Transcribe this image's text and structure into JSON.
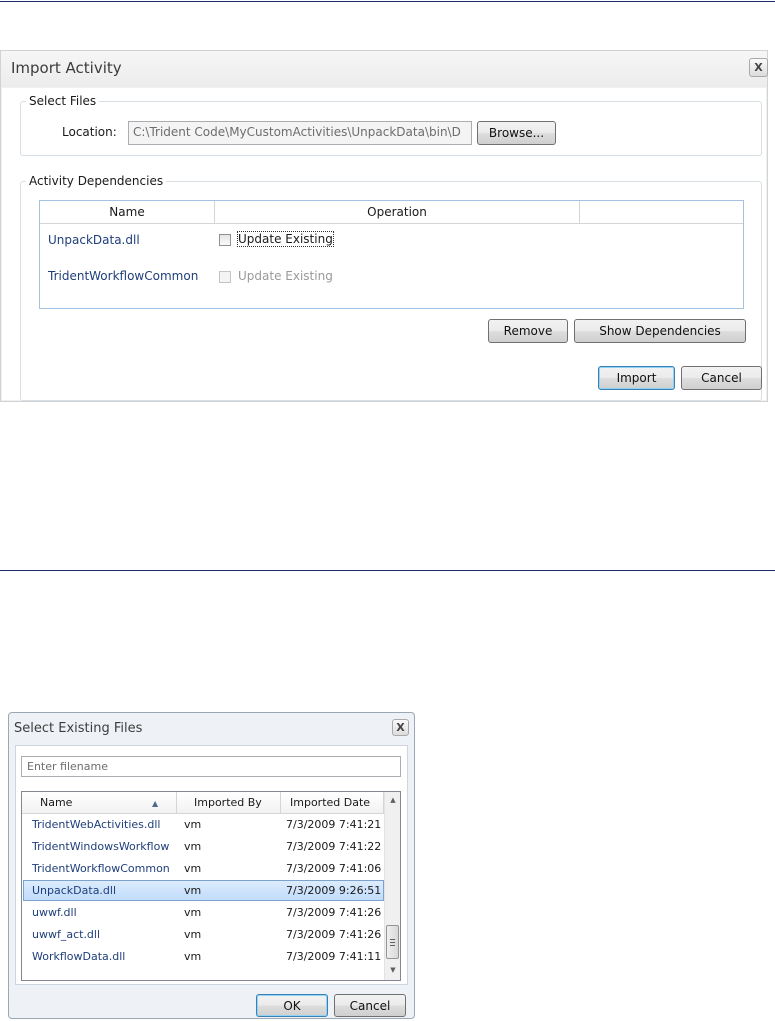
{
  "import_dialog": {
    "title": "Import Activity",
    "close_label": "X",
    "select_files": {
      "legend": "Select Files",
      "location_label": "Location:",
      "location_value": "C:\\Trident Code\\MyCustomActivities\\UnpackData\\bin\\D",
      "browse_label": "Browse..."
    },
    "dependencies": {
      "legend": "Activity Dependencies",
      "columns": [
        "Name",
        "Operation"
      ],
      "rows": [
        {
          "name": "UnpackData.dll",
          "operation": "Update Existing",
          "enabled": true,
          "checked": false
        },
        {
          "name": "TridentWorkflowCommon",
          "operation": "Update Existing",
          "enabled": false,
          "checked": false
        }
      ],
      "remove_label": "Remove",
      "show_dependencies_label": "Show Dependencies"
    },
    "import_label": "Import",
    "cancel_label": "Cancel"
  },
  "select_dialog": {
    "title": "Select Existing Files",
    "close_label": "X",
    "search_placeholder": "Enter filename",
    "columns": {
      "name": "Name",
      "imported_by": "Imported By",
      "imported_date": "Imported Date"
    },
    "sort_column": "Name",
    "sort_direction": "ascending",
    "rows": [
      {
        "name": "TridentWebActivities.dll",
        "imported_by": "vm",
        "imported_date": "7/3/2009 7:41:21"
      },
      {
        "name": "TridentWindowsWorkflow",
        "imported_by": "vm",
        "imported_date": "7/3/2009 7:41:22"
      },
      {
        "name": "TridentWorkflowCommon",
        "imported_by": "vm",
        "imported_date": "7/3/2009 7:41:06"
      },
      {
        "name": "UnpackData.dll",
        "imported_by": "vm",
        "imported_date": "7/3/2009 9:26:51",
        "selected": true
      },
      {
        "name": "uwwf.dll",
        "imported_by": "vm",
        "imported_date": "7/3/2009 7:41:26"
      },
      {
        "name": "uwwf_act.dll",
        "imported_by": "vm",
        "imported_date": "7/3/2009 7:41:26"
      },
      {
        "name": "WorkflowData.dll",
        "imported_by": "vm",
        "imported_date": "7/3/2009 7:41:11"
      }
    ],
    "ok_label": "OK",
    "cancel_label": "Cancel"
  },
  "colors": {
    "rule": "#1f2b6e",
    "link_text": "#1f3f7a",
    "selection": "#c1dcfc",
    "default_button_border": "#3c7fb1"
  }
}
